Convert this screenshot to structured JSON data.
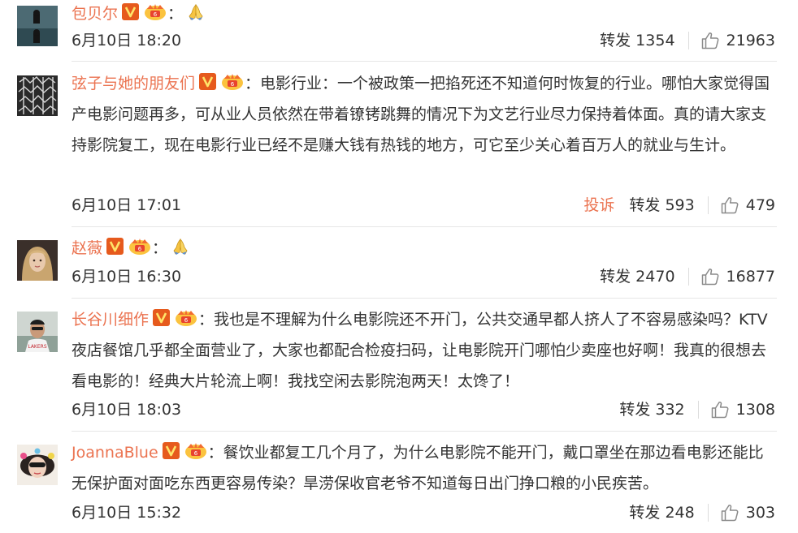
{
  "theme": {
    "name_color": "#eb7350",
    "text_color": "#333333",
    "divider_color": "#e6e6e6"
  },
  "comments": [
    {
      "user": "包贝尔",
      "badges": [
        "v-verified-icon",
        "vip-crown-icon"
      ],
      "text": "：",
      "trailing_emoji": "praying-hands-icon",
      "date": "6月10日 18:20",
      "report_label": "",
      "repost_label": "转发 1354",
      "likes": "21963"
    },
    {
      "user": "弦子与她的朋友们",
      "badges": [
        "v-verified-icon",
        "vip-crown-icon"
      ],
      "text": "：电影行业：一个被政策一把掐死还不知道何时恢复的行业。哪怕大家觉得国产电影问题再多，可从业人员依然在带着镣铐跳舞的情况下为文艺行业尽力保持着体面。真的请大家支持影院复工，现在电影行业已经不是赚大钱有热钱的地方，可它至少关心着百万人的就业与生计。",
      "trailing_emoji": "",
      "date": "6月10日 17:01",
      "report_label": "投诉",
      "repost_label": "转发 593",
      "likes": "479"
    },
    {
      "user": "赵薇",
      "badges": [
        "v-verified-icon",
        "vip-crown-icon"
      ],
      "text": "：",
      "trailing_emoji": "praying-hands-icon",
      "date": "6月10日 16:30",
      "report_label": "",
      "repost_label": "转发 2470",
      "likes": "16877"
    },
    {
      "user": "长谷川细作",
      "badges": [
        "v-verified-icon",
        "vip-crown-icon"
      ],
      "text": "：我也是不理解为什么电影院还不开门，公共交通早都人挤人了不容易感染吗？KTV夜店餐馆几乎都全面营业了，大家也都配合检疫扫码，让电影院开门哪怕少卖座也好啊！我真的很想去看电影的！经典大片轮流上啊！我找空闲去影院泡两天！太馋了！",
      "trailing_emoji": "",
      "date": "6月10日 18:03",
      "report_label": "",
      "repost_label": "转发 332",
      "likes": "1308"
    },
    {
      "user": "JoannaBlue",
      "badges": [
        "v-verified-icon",
        "vip-crown-icon"
      ],
      "text": "：餐饮业都复工几个月了，为什么电影院不能开门，戴口罩坐在那边看电影还能比无保护面对面吃东西更容易传染？旱涝保收官老爷不知道每日出门挣口粮的小民疾苦。",
      "trailing_emoji": "",
      "date": "6月10日 15:32",
      "report_label": "",
      "repost_label": "转发 248",
      "likes": "303"
    }
  ]
}
